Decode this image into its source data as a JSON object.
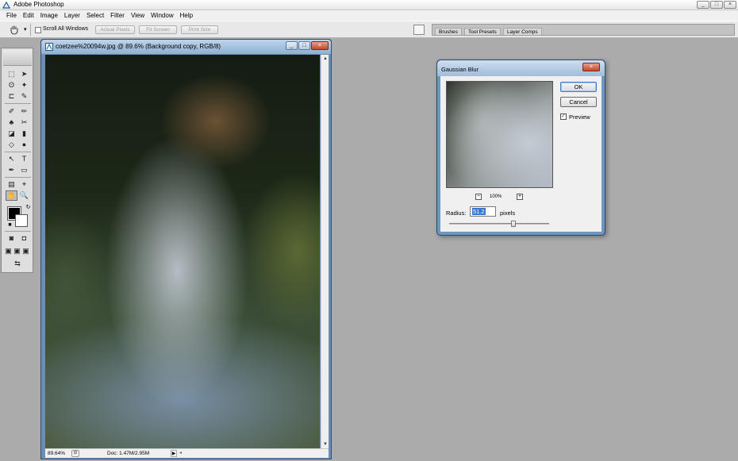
{
  "app": {
    "title": "Adobe Photoshop",
    "window_buttons": [
      "_",
      "□",
      "×"
    ]
  },
  "menu": [
    "File",
    "Edit",
    "Image",
    "Layer",
    "Select",
    "Filter",
    "View",
    "Window",
    "Help"
  ],
  "options": {
    "scroll_all_label": "Scroll All Windows",
    "actual_pixels": "Actual Pixels",
    "fit_screen": "Fit Screen",
    "print_size": "Print Size",
    "caret": "▾"
  },
  "palette_well": {
    "tabs": [
      "Brushes",
      "Tool Presets",
      "Layer Comps"
    ]
  },
  "toolbox": {
    "tools": [
      "⬚",
      "➤",
      "ʘ",
      "✦",
      "⊏",
      "✎",
      "✐",
      "✏",
      "♣",
      "✂",
      "◪",
      "▮",
      "◇",
      "●",
      "↖",
      "T",
      "✒",
      "▭",
      "▤",
      "⌖",
      "✋",
      "🔍"
    ]
  },
  "document": {
    "title": "coetzee%20094w.jpg @ 89.6% (Background copy, RGB/8)",
    "zoom": "89.64%",
    "doc_size": "Doc: 1.47M/2.95M",
    "buttons": [
      "_",
      "□",
      "×"
    ],
    "scroll_up": "▲",
    "scroll_down": "▼",
    "status_arrow": "▶",
    "hscroll_left": "◂"
  },
  "dialog": {
    "title": "Gaussian Blur",
    "close": "×",
    "ok_label": "OK",
    "cancel_label": "Cancel",
    "preview_label": "Preview",
    "preview_checked": "✓",
    "zoom_level": "100%",
    "zoom_minus": "−",
    "zoom_plus": "+",
    "radius_label": "Radius:",
    "radius_value": "51.2",
    "radius_unit": "pixels",
    "slider_fraction": 0.64
  }
}
